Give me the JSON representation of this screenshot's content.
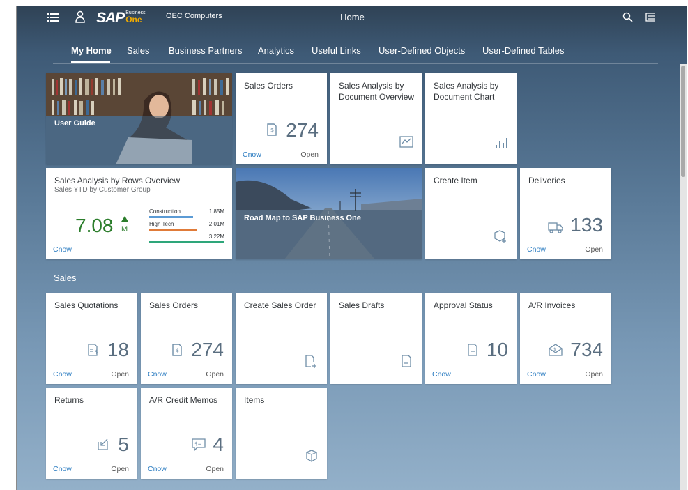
{
  "shell": {
    "company": "OEC Computers",
    "title": "Home",
    "logo_main": "SAP",
    "logo_business": "Business",
    "logo_one": "One"
  },
  "tabs": [
    "My Home",
    "Sales",
    "Business Partners",
    "Analytics",
    "Useful Links",
    "User-Defined Objects",
    "User-Defined Tables"
  ],
  "active_tab": "My Home",
  "home_tiles": {
    "user_guide": "User Guide",
    "sales_orders": {
      "title": "Sales Orders",
      "count": "274",
      "refresh": "now",
      "status": "Open"
    },
    "sales_analysis_doc_overview": {
      "title": "Sales Analysis by Document Overview"
    },
    "sales_analysis_doc_chart": {
      "title": "Sales Analysis by Document Chart"
    },
    "sales_analysis_rows": {
      "title": "Sales Analysis by Rows Overview",
      "subtitle": "Sales YTD by Customer Group",
      "kpi": "7.08",
      "kpi_unit": "M",
      "refresh": "now",
      "bars": [
        {
          "label": "Construction",
          "value": "1.85M",
          "fraction": 0.58,
          "color": "#5b9bd5"
        },
        {
          "label": "High Tech",
          "value": "2.01M",
          "fraction": 0.63,
          "color": "#e07b39"
        },
        {
          "label": "...",
          "value": "3.22M",
          "fraction": 1.0,
          "color": "#2ea67a"
        }
      ]
    },
    "road_map": "Road Map to SAP Business One",
    "create_item": {
      "title": "Create Item"
    },
    "deliveries": {
      "title": "Deliveries",
      "count": "133",
      "refresh": "now",
      "status": "Open"
    }
  },
  "sales_section": {
    "title": "Sales",
    "tiles": {
      "sales_quotations": {
        "title": "Sales Quotations",
        "count": "18",
        "refresh": "now",
        "status": "Open"
      },
      "sales_orders": {
        "title": "Sales Orders",
        "count": "274",
        "refresh": "now",
        "status": "Open"
      },
      "create_sales_order": {
        "title": "Create Sales Order"
      },
      "sales_drafts": {
        "title": "Sales Drafts"
      },
      "approval_status": {
        "title": "Approval Status",
        "count": "10",
        "refresh": "now"
      },
      "ar_invoices": {
        "title": "A/R Invoices",
        "count": "734",
        "refresh": "now",
        "status": "Open"
      },
      "returns": {
        "title": "Returns",
        "count": "5",
        "refresh": "now",
        "status": "Open"
      },
      "ar_credit_memos": {
        "title": "A/R Credit Memos",
        "count": "4",
        "refresh": "now",
        "status": "Open"
      },
      "items": {
        "title": "Items"
      }
    }
  },
  "colors": {
    "accent": "#2b7cc1",
    "kpi_green": "#2b7d2b",
    "tile_icon": "#6f8ea8"
  }
}
